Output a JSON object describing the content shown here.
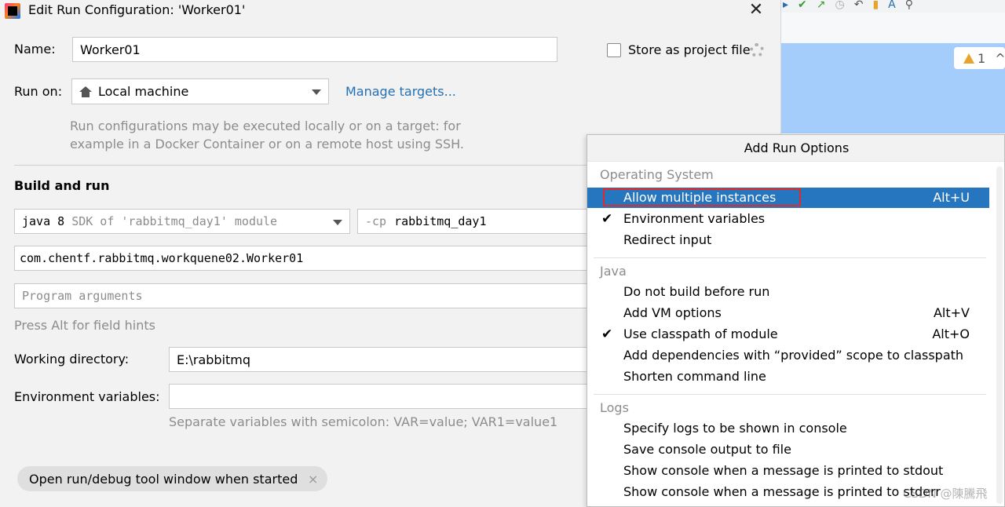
{
  "dialog": {
    "title": "Edit Run Configuration: 'Worker01'",
    "close_glyph": "✕",
    "name_label": "Name:",
    "name_value": "Worker01",
    "store_label": "Store as project file",
    "run_on_label": "Run on:",
    "run_on_value": "Local machine",
    "manage_targets": "Manage targets...",
    "run_on_hint_1": "Run configurations may be executed locally or on a target: for",
    "run_on_hint_2": "example in a Docker Container or on a remote host using SSH.",
    "build_and_run": "Build and run",
    "sdk_java": "java 8",
    "sdk_rest": "SDK of 'rabbitmq_day1' module",
    "cp_flag": "-cp",
    "cp_value": "rabbitmq_day1",
    "main_class": "com.chentf.rabbitmq.workquene02.Worker01",
    "program_args_placeholder": "Program arguments",
    "press_alt_hint": "Press Alt for field hints",
    "working_dir_label": "Working directory:",
    "working_dir_value": "E:\\rabbitmq",
    "env_vars_label": "Environment variables:",
    "env_vars_value": "",
    "env_vars_hint": "Separate variables with semicolon: VAR=value; VAR1=value1",
    "chip_label": "Open run/debug tool window when started",
    "chip_close": "×"
  },
  "ide": {
    "warning_count": "1"
  },
  "popup": {
    "title": "Add Run Options",
    "groups": [
      {
        "name": "Operating System",
        "options": [
          {
            "label": "Allow multiple instances",
            "shortcut": "Alt+U",
            "checked": false,
            "selected": true
          },
          {
            "label": "Environment variables",
            "shortcut": "",
            "checked": true,
            "selected": false
          },
          {
            "label": "Redirect input",
            "shortcut": "",
            "checked": false,
            "selected": false
          }
        ]
      },
      {
        "name": "Java",
        "options": [
          {
            "label": "Do not build before run",
            "shortcut": "",
            "checked": false,
            "selected": false
          },
          {
            "label": "Add VM options",
            "shortcut": "Alt+V",
            "checked": false,
            "selected": false
          },
          {
            "label": "Use classpath of module",
            "shortcut": "Alt+O",
            "checked": true,
            "selected": false
          },
          {
            "label": "Add dependencies with “provided” scope to classpath",
            "shortcut": "",
            "checked": false,
            "selected": false
          },
          {
            "label": "Shorten command line",
            "shortcut": "",
            "checked": false,
            "selected": false
          }
        ]
      },
      {
        "name": "Logs",
        "options": [
          {
            "label": "Specify logs to be shown in console",
            "shortcut": "",
            "checked": false,
            "selected": false
          },
          {
            "label": "Save console output to file",
            "shortcut": "",
            "checked": false,
            "selected": false
          },
          {
            "label": "Show console when a message is printed to stdout",
            "shortcut": "",
            "checked": false,
            "selected": false
          },
          {
            "label": "Show console when a message is printed to stderr",
            "shortcut": "",
            "checked": false,
            "selected": false
          }
        ]
      }
    ],
    "check_glyph": "✔"
  },
  "watermark": "CSDN @陳騰飛",
  "colors": {
    "selection": "#2675bf",
    "highlight_box": "#e12b2b",
    "link": "#2470b3",
    "editor_bg": "#a4cdfb"
  }
}
